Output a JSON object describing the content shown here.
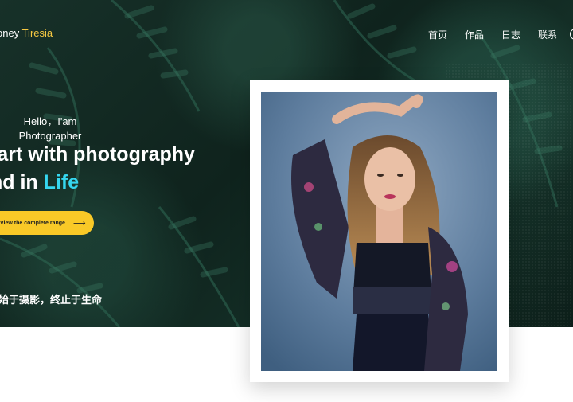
{
  "header": {
    "logo_main": "oney",
    "logo_accent": "Tiresia",
    "nav": [
      "首页",
      "作品",
      "日志",
      "联系"
    ]
  },
  "hero": {
    "hello_line1": "Hello，I'am",
    "hello_line2": "Photographer",
    "headline_line1": "tart with photography",
    "headline_line2_prefix": "nd in",
    "headline_line2_accent": "Life",
    "cta_label": "View the complete range",
    "cta_arrow": "⟶",
    "slogan": "始于摄影，终止于生命"
  },
  "colors": {
    "accent_yellow": "#f9c927",
    "accent_cyan": "#36d7f0",
    "logo_accent": "#f5c842"
  },
  "icons": [
    "menu-toggle-icon",
    "arrow-right-icon"
  ]
}
